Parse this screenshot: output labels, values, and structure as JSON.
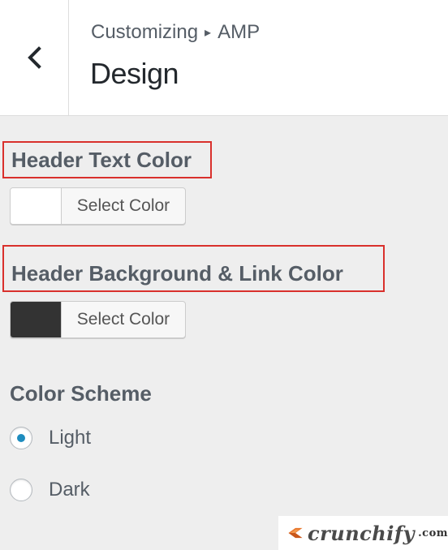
{
  "breadcrumb": {
    "parent": "Customizing",
    "separator": "▸",
    "current": "AMP"
  },
  "panel_title": "Design",
  "header_text_color": {
    "label": "Header Text Color",
    "button_label": "Select Color",
    "swatch_color": "#ffffff"
  },
  "header_bg_color": {
    "label": "Header Background & Link Color",
    "button_label": "Select Color",
    "swatch_color": "#333333"
  },
  "color_scheme": {
    "title": "Color Scheme",
    "options": [
      {
        "label": "Light",
        "selected": true
      },
      {
        "label": "Dark",
        "selected": false
      }
    ]
  },
  "watermark": {
    "name": "crunchify",
    "tld": ".com"
  },
  "colors": {
    "accent": "#1e8cbe",
    "highlight_box": "#d9302c"
  }
}
